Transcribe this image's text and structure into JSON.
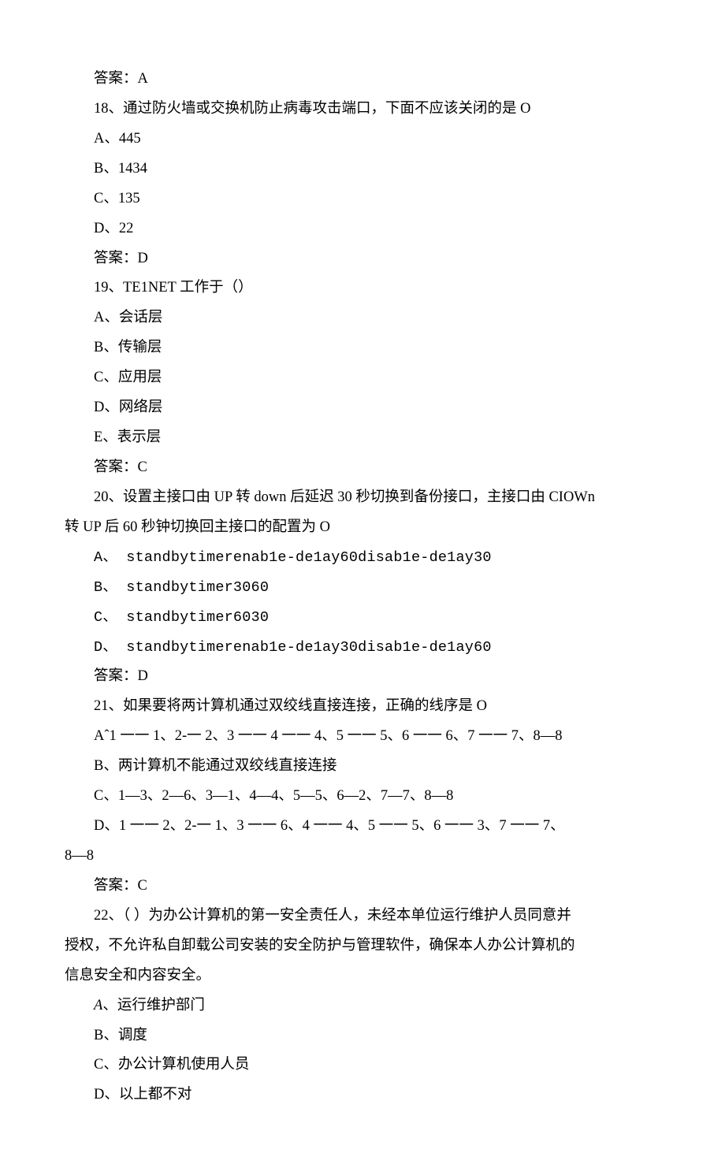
{
  "lines": [
    {
      "text": "答案：A",
      "indent": true
    },
    {
      "text": "18、通过防火墙或交换机防止病毒攻击端口，下面不应该关闭的是 O",
      "indent": true
    },
    {
      "text": "A、445",
      "indent": true
    },
    {
      "text": "B、1434",
      "indent": true
    },
    {
      "text": "C、135",
      "indent": true
    },
    {
      "text": "D、22",
      "indent": true
    },
    {
      "text": "答案：D",
      "indent": true
    },
    {
      "text": "19、TE1NET 工作于（）",
      "indent": true
    },
    {
      "text": "A、会话层",
      "indent": true
    },
    {
      "text": "B、传输层",
      "indent": true
    },
    {
      "text": "C、应用层",
      "indent": true
    },
    {
      "text": "D、网络层",
      "indent": true
    },
    {
      "text": "E、表示层",
      "indent": true
    },
    {
      "text": "答案：C",
      "indent": true
    },
    {
      "text": "20、设置主接口由 UP 转 down 后延迟 30 秒切换到备份接口，主接口由 CIOWn",
      "indent": true
    },
    {
      "text": "转 UP 后 60 秒钟切换回主接口的配置为 O",
      "indent": false
    },
    {
      "text": "A、 standbytimerenab1e-de1ay60disab1e-de1ay30",
      "indent": true,
      "mono": true
    },
    {
      "text": "B、 standbytimer3060",
      "indent": true,
      "mono": true
    },
    {
      "text": "C、 standbytimer6030",
      "indent": true,
      "mono": true
    },
    {
      "text": "D、 standbytimerenab1e-de1ay30disab1e-de1ay60",
      "indent": true,
      "mono": true
    },
    {
      "text": "答案：D",
      "indent": true
    },
    {
      "text": "21、如果要将两计算机通过双绞线直接连接，正确的线序是 O",
      "indent": true
    },
    {
      "text": "Aˆ1 一一 1、2-一 2、3 一一 4 一一 4、5 一一 5、6 一一 6、7 一一 7、8—8",
      "indent": true
    },
    {
      "text": "B、两计算机不能通过双绞线直接连接",
      "indent": true
    },
    {
      "text": "C、1—3、2—6、3—1、4—4、5—5、6—2、7—7、8—8",
      "indent": true
    },
    {
      "text": "D、1 一一 2、2-一 1、3 一一 6、4 一一 4、5 一一 5、6 一一 3、7 一一 7、",
      "indent": true
    },
    {
      "text": "8—8",
      "indent": false
    },
    {
      "text": "答案：C",
      "indent": true
    },
    {
      "text": "22、（ ）为办公计算机的第一安全责任人，未经本单位运行维护人员同意并",
      "indent": true
    },
    {
      "text": "授权，不允许私自卸载公司安装的安全防护与管理软件，确保本人办公计算机的",
      "indent": false
    },
    {
      "text": "信息安全和内容安全。",
      "indent": false
    },
    {
      "text": "A、运行维护部门",
      "indent": true,
      "italicFirst": true
    },
    {
      "text": "B、调度",
      "indent": true
    },
    {
      "text": "C、办公计算机使用人员",
      "indent": true
    },
    {
      "text": "D、以上都不对",
      "indent": true
    }
  ]
}
